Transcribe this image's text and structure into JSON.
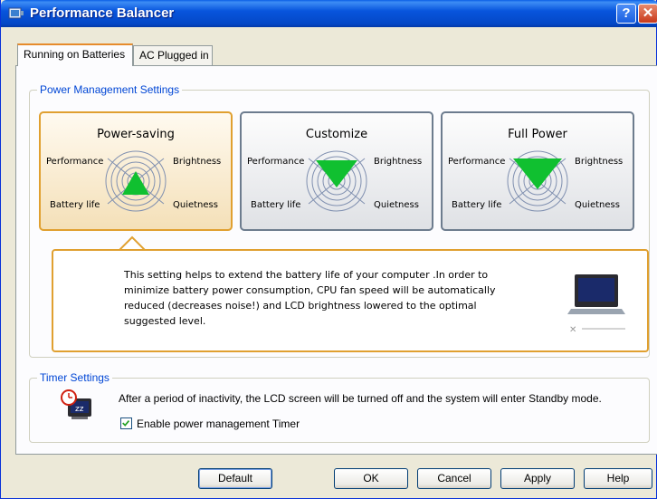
{
  "window": {
    "title": "Performance Balancer",
    "help_glyph": "?",
    "close_glyph": "✕"
  },
  "tabs": [
    {
      "label": "Running on Batteries",
      "active": true
    },
    {
      "label": "AC Plugged in",
      "active": false
    }
  ],
  "power_group": {
    "label": "Power Management Settings",
    "modes": [
      {
        "name": "Power-saving",
        "selected": true
      },
      {
        "name": "Customize",
        "selected": false
      },
      {
        "name": "Full Power",
        "selected": false
      }
    ],
    "axis_labels": {
      "top_left": "Performance",
      "top_right": "Brightness",
      "bottom_left": "Battery life",
      "bottom_right": "Quietness"
    },
    "description": "This setting helps to extend the battery life of your computer .In order to minimize battery power consumption, CPU fan speed will be automatically reduced (decreases noise!) and LCD brightness lowered to the optimal suggested level."
  },
  "timer_group": {
    "label": "Timer Settings",
    "message": "After a period of inactivity, the LCD screen will be turned off and the system will enter Standby mode.",
    "checkbox_label": "Enable power management Timer",
    "checkbox_checked": true
  },
  "buttons": {
    "default": "Default",
    "ok": "OK",
    "cancel": "Cancel",
    "apply": "Apply",
    "help": "Help"
  },
  "colors": {
    "title_bar": "#0855dd",
    "selected_border": "#e0a030",
    "radar_fill": "#10c030",
    "group_label": "#0046d5"
  }
}
